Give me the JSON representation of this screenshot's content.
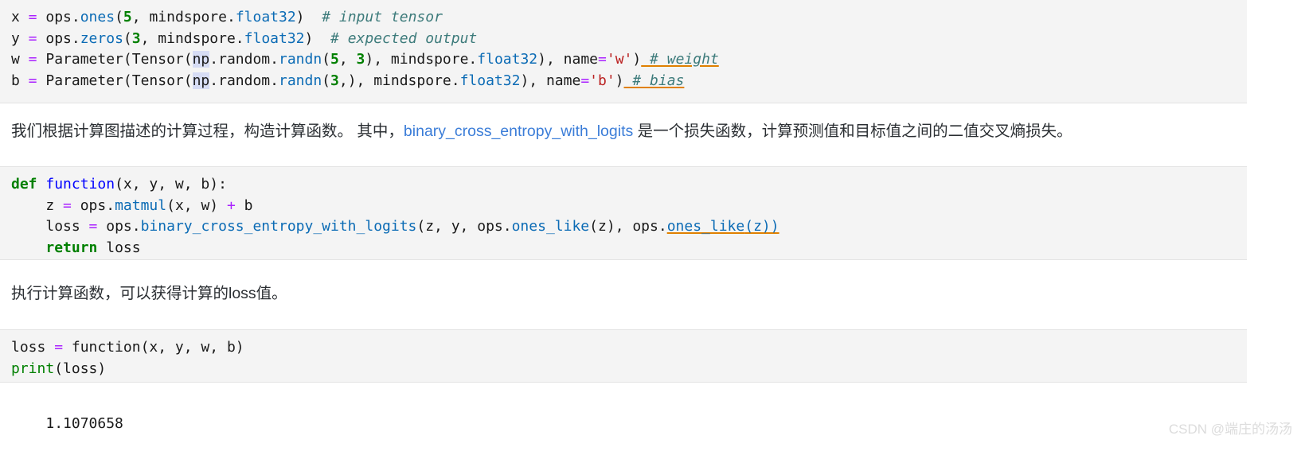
{
  "colors": {
    "cell_background": "#f4f4f4",
    "cell_border": "#e3e3e3",
    "page_background": "#ffffff",
    "operator": "#aa22ff",
    "function_name": "#0000ff",
    "attribute_call": "#0b6bb5",
    "number": "#008000",
    "string": "#ba2121",
    "keyword": "#008000",
    "comment": "#3d7b7b",
    "markdown_link": "#3b7dd8",
    "bracket_highlight": "#d6dcf5",
    "squiggle_underline": "#e08000",
    "watermark": "#dcdcdc",
    "body_text": "#2b2f33"
  },
  "cells": {
    "code_cell_1": {
      "language": "python",
      "lines": [
        "x = ops.ones(5, mindspore.float32)  # input tensor",
        "y = ops.zeros(3, mindspore.float32)  # expected output",
        "w = Parameter(Tensor(np.random.randn(5, 3), mindspore.float32), name='w') # weight",
        "b = Parameter(Tensor(np.random.randn(3,), mindspore.float32), name='b') # bias"
      ],
      "line1": {
        "var": "x",
        "eq": " = ",
        "mod": "ops.",
        "fn": "ones",
        "open": "(",
        "num": "5",
        "arg": ", mindspore.",
        "dtype": "float32",
        "close": ")",
        "comment": "# input tensor"
      },
      "line2": {
        "var": "y",
        "eq": " = ",
        "mod": "ops.",
        "fn": "zeros",
        "open": "(",
        "num": "3",
        "arg": ", mindspore.",
        "dtype": "float32",
        "close": ")",
        "comment": "# expected output"
      },
      "line3": {
        "var": "w",
        "eq": " = ",
        "ctor": "Parameter(Tensor(",
        "np": "np",
        "npattr": ".random.",
        "randn": "randn",
        "open": "(",
        "num1": "5",
        "sep": ", ",
        "num2": "3",
        "mid": "), mindspore.",
        "dtype": "float32",
        "after": "), ",
        "kwname": "name",
        "kweq": "=",
        "kwval": "'w'",
        "close": ")",
        "comment": " # weight"
      },
      "line4": {
        "var": "b",
        "eq": " = ",
        "ctor": "Parameter(Tensor(",
        "np": "np",
        "npattr": ".random.",
        "randn": "randn",
        "open": "(",
        "num1": "3",
        "mid": ",), mindspore.",
        "dtype": "float32",
        "after": "), ",
        "kwname": "name",
        "kweq": "=",
        "kwval": "'b'",
        "close": ")",
        "comment": " # bias"
      }
    },
    "markdown_cell_1": {
      "text_before_link": "我们根据计算图描述的计算过程，构造计算函数。 其中，",
      "link": "binary_cross_entropy_with_logits",
      "text_after_link": " 是一个损失函数，计算预测值和目标值之间的二值交叉熵损失。"
    },
    "code_cell_2": {
      "language": "python",
      "lines": [
        "def function(x, y, w, b):",
        "    z = ops.matmul(x, w) + b",
        "    loss = ops.binary_cross_entropy_with_logits(z, y, ops.ones_like(z), ops.ones_like(z))",
        "    return loss"
      ],
      "line1": {
        "kw": "def",
        "space": " ",
        "fn": "function",
        "params": "(x, y, w, b):"
      },
      "line2": {
        "indent": "    ",
        "var": "z",
        "eq": " = ",
        "mod": "ops.",
        "fn": "matmul",
        "args": "(x, w) ",
        "plus": "+",
        "tail": " b"
      },
      "line3": {
        "indent": "    ",
        "var": "loss",
        "eq": " = ",
        "mod": "ops.",
        "fn": "binary_cross_entropy_with_logits",
        "args1": "(z, y, ops.",
        "fn2": "ones_like",
        "args2": "(z), ops.",
        "fn3": "ones_like",
        "args3": "(z))"
      },
      "line4": {
        "indent": "    ",
        "kw": "return",
        "tail": " loss"
      }
    },
    "markdown_cell_2": {
      "text": "执行计算函数，可以获得计算的loss值。"
    },
    "code_cell_3": {
      "language": "python",
      "lines": [
        "loss = function(x, y, w, b)",
        "print(loss)"
      ],
      "line1": {
        "var": "loss",
        "eq": " = ",
        "fn": "function",
        "args": "(x, y, w, b)"
      },
      "line2": {
        "builtin": "print",
        "args": "(loss)"
      }
    },
    "output_cell_1": {
      "text": "1.1070658"
    }
  },
  "watermark": {
    "text": "CSDN @端庄的汤汤"
  }
}
